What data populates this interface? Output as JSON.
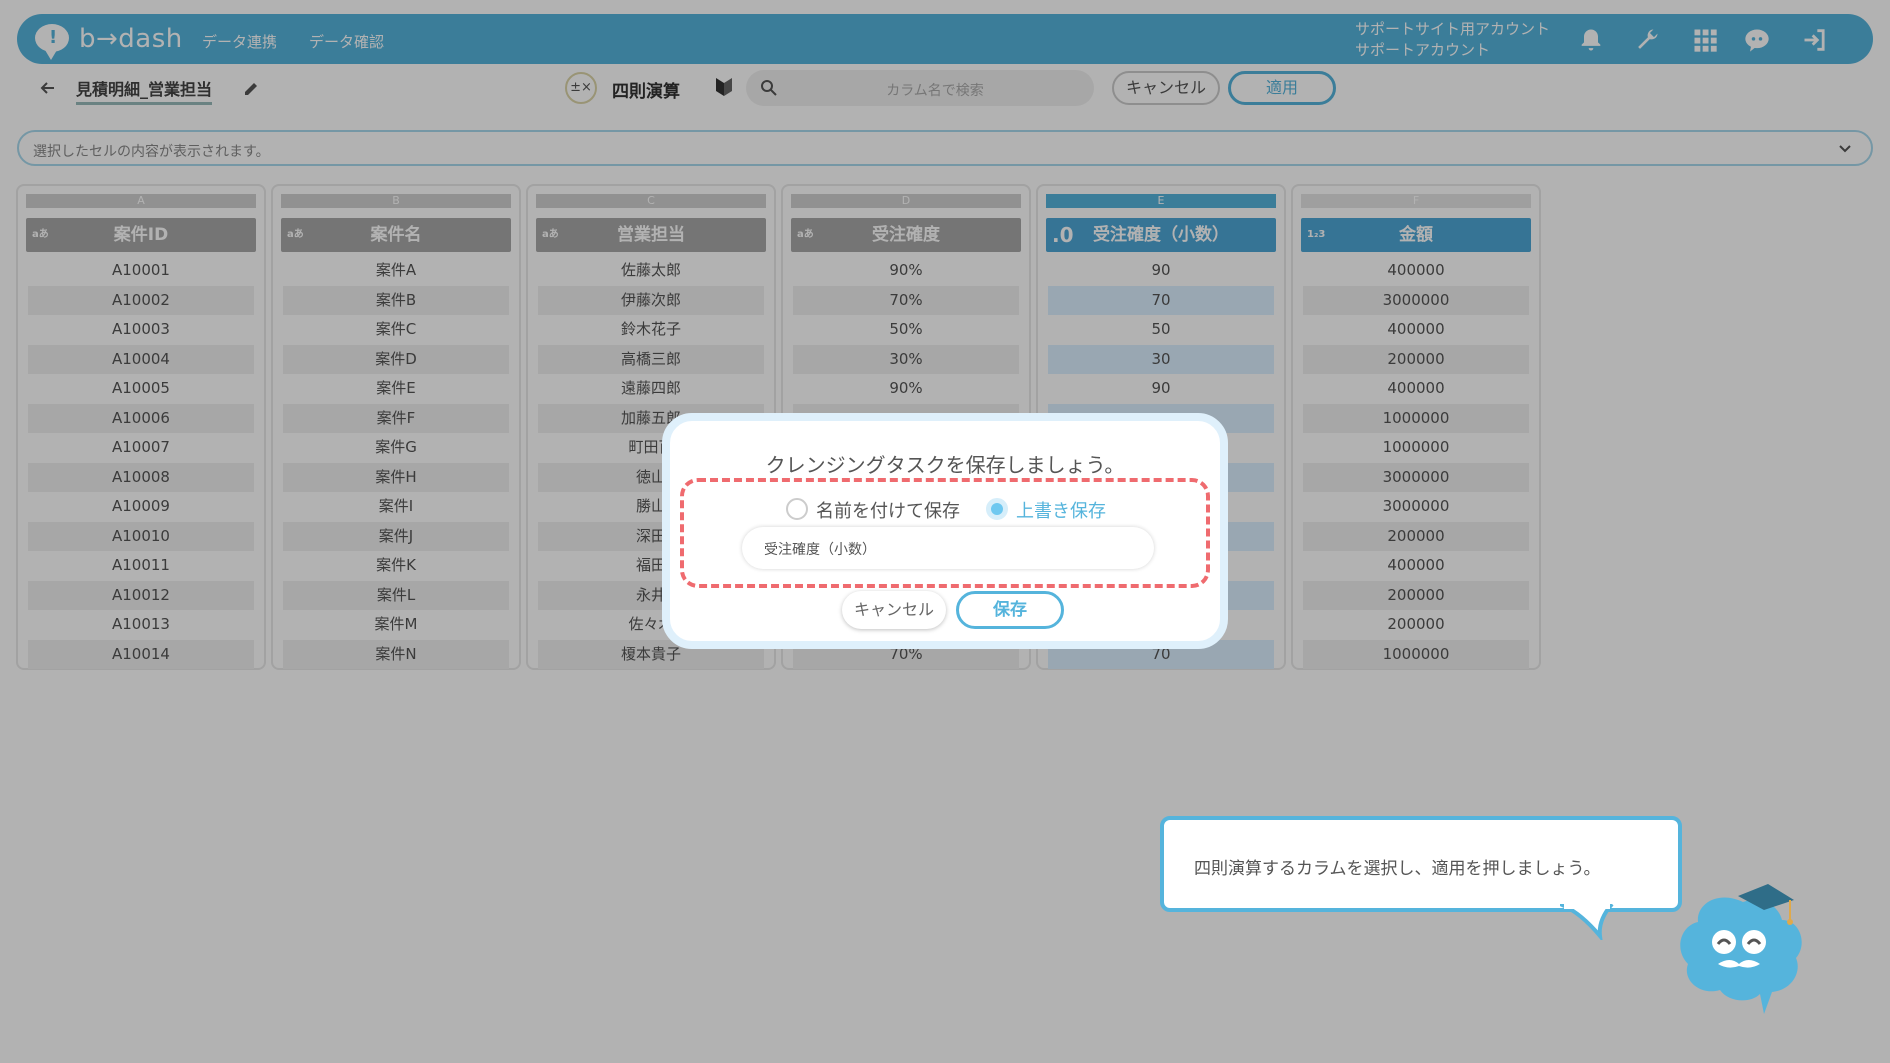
{
  "header": {
    "logo_text": "b→dash",
    "nav": [
      "データ連携",
      "データ確認"
    ],
    "account_line1": "サポートサイト用アカウント",
    "account_line2": "サポートアカウント",
    "icons": [
      "bell-icon",
      "wrench-icon",
      "grid-icon",
      "chat-icon",
      "logout-icon"
    ]
  },
  "toolbar": {
    "file_title": "見積明細_営業担当",
    "mode_title": "四則演算",
    "calc_icon_text": "±×",
    "search_placeholder": "カラム名で検索",
    "cancel_label": "キャンセル",
    "apply_label": "適用"
  },
  "cellbar": {
    "placeholder": "選択したセルの内容が表示されます。"
  },
  "columns": [
    {
      "letter": "A",
      "name": "案件ID",
      "type": "aあ",
      "values": [
        "A10001",
        "A10002",
        "A10003",
        "A10004",
        "A10005",
        "A10006",
        "A10007",
        "A10008",
        "A10009",
        "A10010",
        "A10011",
        "A10012",
        "A10013",
        "A10014"
      ]
    },
    {
      "letter": "B",
      "name": "案件名",
      "type": "aあ",
      "values": [
        "案件A",
        "案件B",
        "案件C",
        "案件D",
        "案件E",
        "案件F",
        "案件G",
        "案件H",
        "案件I",
        "案件J",
        "案件K",
        "案件L",
        "案件M",
        "案件N"
      ]
    },
    {
      "letter": "C",
      "name": "営業担当",
      "type": "aあ",
      "values": [
        "佐藤太郎",
        "伊藤次郎",
        "鈴木花子",
        "高橋三郎",
        "遠藤四郎",
        "加藤五郎",
        "町田百",
        "徳山",
        "勝山",
        "深田",
        "福田",
        "永井",
        "佐々木",
        "榎本貴子"
      ]
    },
    {
      "letter": "D",
      "name": "受注確度",
      "type": "aあ",
      "values": [
        "90%",
        "70%",
        "50%",
        "30%",
        "90%",
        "",
        "",
        "",
        "",
        "",
        "",
        "",
        "",
        "70%"
      ]
    },
    {
      "letter": "E",
      "name": "受注確度（小数）",
      "type": ".0",
      "values": [
        "90",
        "70",
        "50",
        "30",
        "90",
        "",
        "",
        "",
        "",
        "",
        "",
        "",
        "",
        "70"
      ]
    },
    {
      "letter": "F",
      "name": "金額",
      "type": "1₂3",
      "values": [
        "400000",
        "3000000",
        "400000",
        "200000",
        "400000",
        "1000000",
        "1000000",
        "3000000",
        "3000000",
        "200000",
        "400000",
        "200000",
        "200000",
        "1000000"
      ]
    }
  ],
  "dialog": {
    "title": "クレンジングタスクを保存しましょう。",
    "option_save_as": "名前を付けて保存",
    "option_overwrite": "上書き保存",
    "selected_option": "上書き保存",
    "name_value": "受注確度（小数）",
    "cancel_label": "キャンセル",
    "save_label": "保存"
  },
  "tip": {
    "text": "四則演算するカラムを選択し、適用を押しましょう。"
  },
  "colors": {
    "accent": "#55b4dc",
    "highlight_dash": "#ef6b6f"
  }
}
